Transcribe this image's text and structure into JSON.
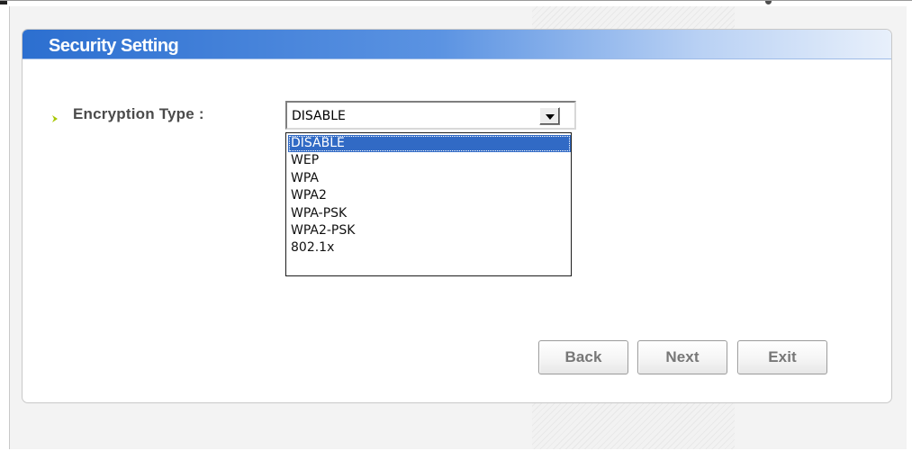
{
  "panel": {
    "title": "Security Setting"
  },
  "encryption": {
    "label": "Encryption Type :",
    "selected_value": "DISABLE",
    "options": [
      "DISABLE",
      "WEP",
      "WPA",
      "WPA2",
      "WPA-PSK",
      "WPA2-PSK",
      "802.1x"
    ]
  },
  "buttons": {
    "back": "Back",
    "next": "Next",
    "exit": "Exit"
  },
  "colors": {
    "header_blue": "#2c6fd0",
    "selected_option": "#316ac5",
    "label_arrow": "#a7c700"
  },
  "icons": {
    "label_arrow": "chevron-right-icon",
    "select_caret": "chevron-down-icon"
  }
}
